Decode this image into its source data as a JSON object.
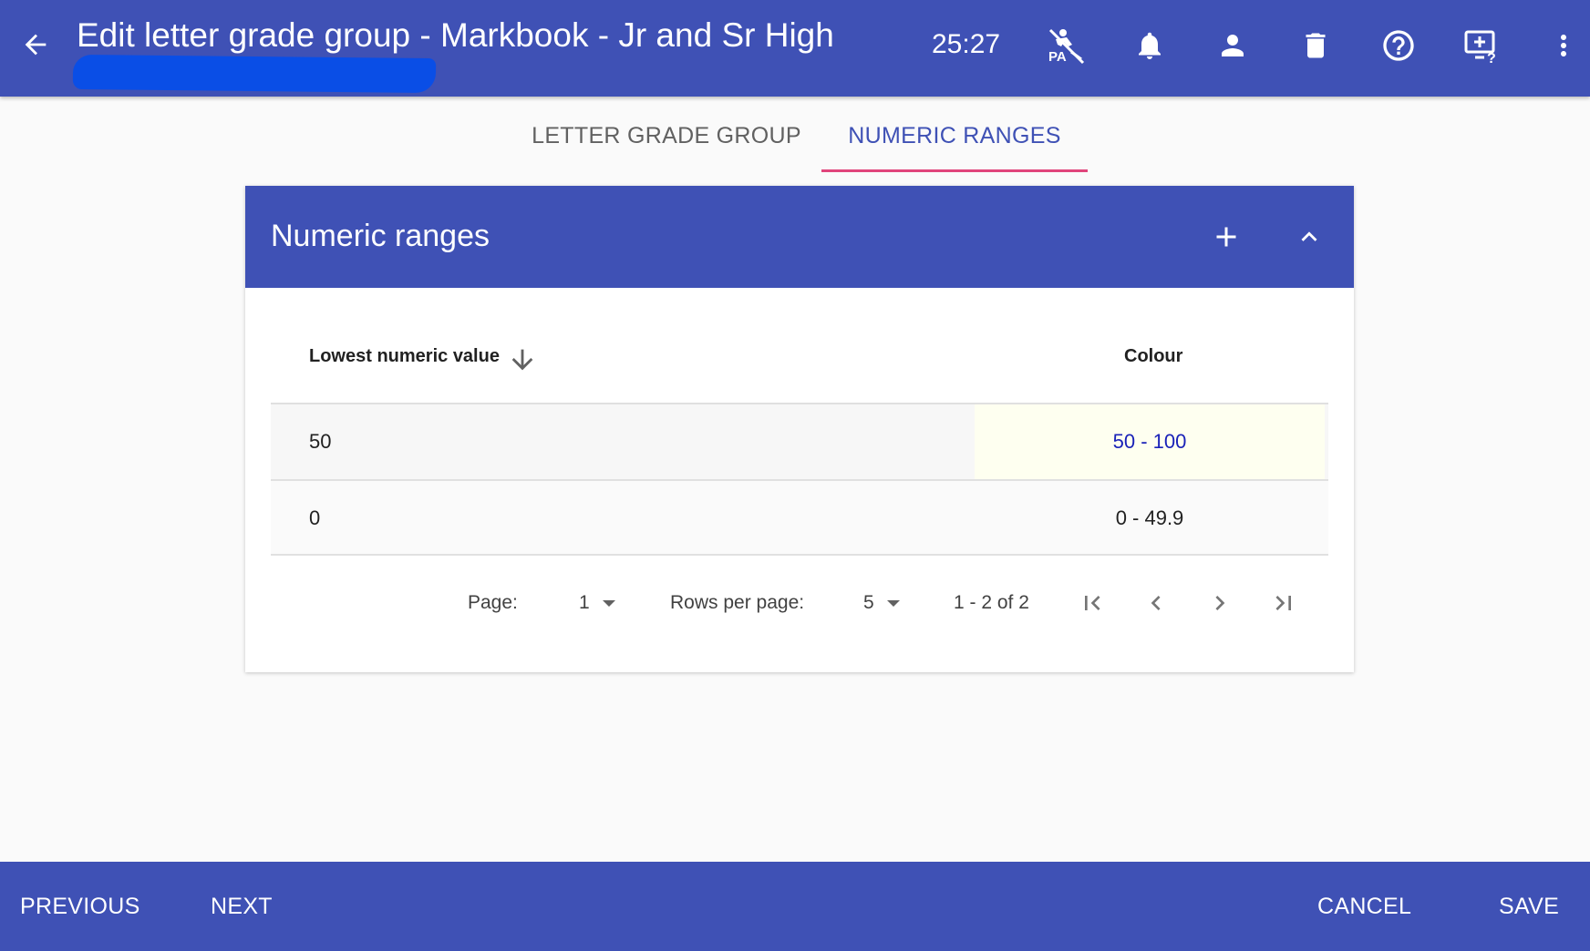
{
  "appbar": {
    "title": "Edit letter grade group - Markbook - Jr and Sr High",
    "timer": "25:27",
    "icons": [
      "back-arrow-icon",
      "pass-off-icon",
      "bell-icon",
      "account-icon",
      "trash-icon",
      "help-icon",
      "screen-help-icon",
      "more-vert-icon"
    ]
  },
  "tabs": {
    "letter_grade_group": "LETTER GRADE GROUP",
    "numeric_ranges": "NUMERIC RANGES",
    "active": "numeric_ranges"
  },
  "card": {
    "title": "Numeric ranges",
    "columns": {
      "lowest": "Lowest numeric value",
      "colour": "Colour"
    },
    "rows": [
      {
        "lowest": "50",
        "colour": "50 - 100"
      },
      {
        "lowest": "0",
        "colour": "0 - 49.9"
      }
    ],
    "pager": {
      "page_label": "Page:",
      "page_value": "1",
      "rows_label": "Rows per page:",
      "rows_value": "5",
      "range": "1 - 2 of 2"
    }
  },
  "bottombar": {
    "previous": "PREVIOUS",
    "next": "NEXT",
    "cancel": "CANCEL",
    "save": "SAVE"
  },
  "colors": {
    "primary": "#3f51b5",
    "tab_indicator": "#e0457b",
    "highlight_cell": "#fefff0",
    "highlight_text": "#1a22b8"
  }
}
